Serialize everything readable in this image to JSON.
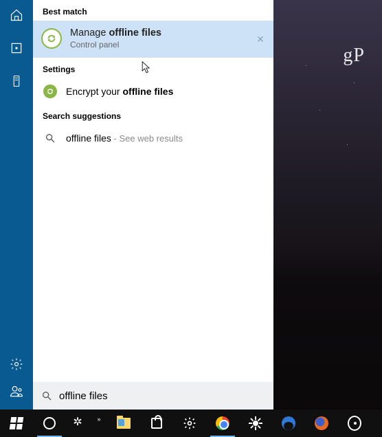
{
  "watermark": "gP",
  "sections": {
    "best_match": "Best match",
    "settings": "Settings",
    "suggestions": "Search suggestions"
  },
  "best_match": {
    "title_pre": "Manage ",
    "title_bold": "offline files",
    "subtitle": "Control panel"
  },
  "settings_item": {
    "pre": "Encrypt your ",
    "bold": "offline files"
  },
  "suggestion": {
    "query": "offline files",
    "tail": " - See web results"
  },
  "search": {
    "value": "offline files"
  },
  "rail": {
    "home": "home-icon",
    "box": "box-icon",
    "device": "device-icon",
    "settings": "settings-icon",
    "user": "user-icon"
  },
  "taskbar": {
    "start": "start-button",
    "cortana": "cortana-button",
    "dropbox": "dropbox-button",
    "overflow": "overflow-button",
    "explorer": "file-explorer",
    "store": "store",
    "win_settings": "settings",
    "chrome": "chrome",
    "brightness": "brightness",
    "edge": "edge",
    "firefox": "firefox",
    "tray": "target-tray"
  }
}
